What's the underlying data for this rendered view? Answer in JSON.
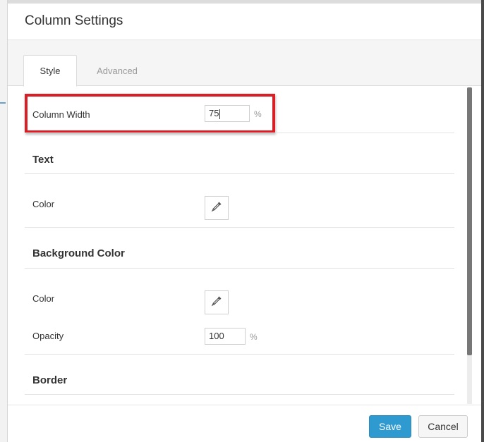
{
  "dialog": {
    "title": "Column Settings"
  },
  "tabs": [
    {
      "label": "Style",
      "active": true
    },
    {
      "label": "Advanced",
      "active": false
    }
  ],
  "column_width": {
    "label": "Column Width",
    "value": "75",
    "unit": "%"
  },
  "sections": {
    "text": {
      "title": "Text",
      "color_label": "Color",
      "color_icon": "eyedropper-icon"
    },
    "background": {
      "title": "Background Color",
      "color_label": "Color",
      "color_icon": "eyedropper-icon",
      "opacity_label": "Opacity",
      "opacity_value": "100",
      "opacity_unit": "%"
    },
    "border": {
      "title": "Border"
    }
  },
  "footer": {
    "save_label": "Save",
    "cancel_label": "Cancel"
  },
  "colors": {
    "highlight": "#d81f26",
    "primary_button": "#2e9ad0"
  }
}
